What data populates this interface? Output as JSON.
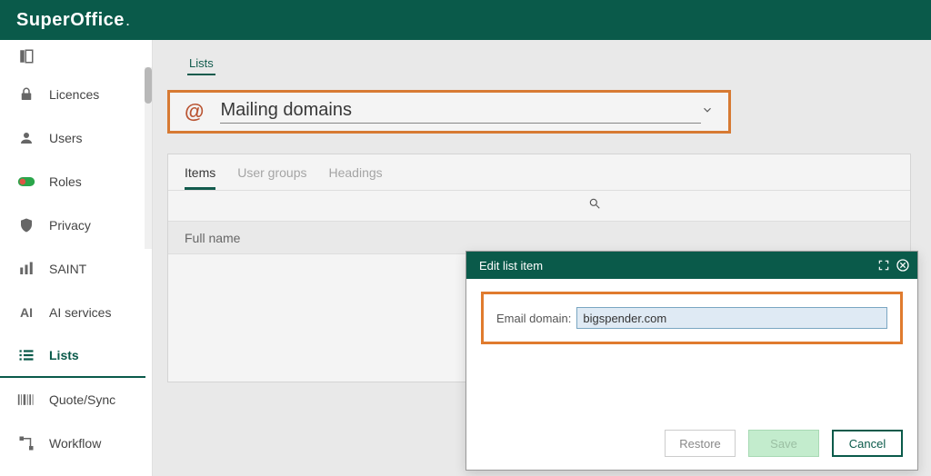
{
  "brand": {
    "name_a": "Super",
    "name_b": "Office",
    "dot": "."
  },
  "sidebar": {
    "items": [
      {
        "id": "licences",
        "label": "Licences"
      },
      {
        "id": "users",
        "label": "Users"
      },
      {
        "id": "roles",
        "label": "Roles"
      },
      {
        "id": "privacy",
        "label": "Privacy"
      },
      {
        "id": "saint",
        "label": "SAINT"
      },
      {
        "id": "ai",
        "label": "AI services"
      },
      {
        "id": "lists",
        "label": "Lists"
      },
      {
        "id": "quote",
        "label": "Quote/Sync"
      },
      {
        "id": "workflow",
        "label": "Workflow"
      }
    ],
    "active_id": "lists"
  },
  "main": {
    "top_tab": "Lists",
    "selector": {
      "icon": "@",
      "label": "Mailing domains"
    },
    "subtabs": [
      {
        "id": "items",
        "label": "Items",
        "active": true
      },
      {
        "id": "ug",
        "label": "User groups",
        "active": false
      },
      {
        "id": "hd",
        "label": "Headings",
        "active": false
      }
    ],
    "grid_columns": [
      "Full name"
    ]
  },
  "dialog": {
    "title": "Edit list item",
    "field_label": "Email domain:",
    "field_value": "bigspender.com",
    "actions": {
      "restore": "Restore",
      "save": "Save",
      "cancel": "Cancel"
    }
  }
}
